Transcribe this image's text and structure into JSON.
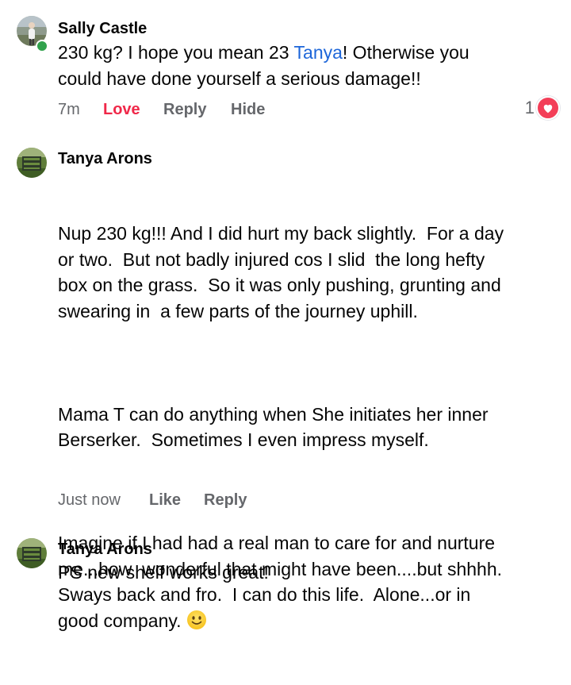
{
  "comments": [
    {
      "author": "Sally Castle",
      "online": true,
      "text_before_mention": "230 kg? I hope you mean 23 ",
      "mention": "Tanya",
      "text_after_mention": "! Otherwise you\ncould have done yourself a serious damage!!",
      "time": "7m",
      "love_label": "Love",
      "reply_label": "Reply",
      "hide_label": "Hide",
      "reaction_count": "1",
      "reaction_icon": "heart-icon"
    },
    {
      "author": "Tanya Arons",
      "paragraph1": "Nup 230 kg!!! And I did hurt my back slightly.  For a day\nor two.  But not badly injured cos I slid  the long hefty\nbox on the grass.  So it was only pushing, grunting and\nswearing in  a few parts of the journey uphill.",
      "paragraph2": "Mama T can do anything when She initiates her inner\nBerserker.  Sometimes I even impress myself.",
      "paragraph3": "Imagine if I had had a real man to care for and nurture\nme...how  wonderful that might have been....but shhhh.\nSways back and fro.  I can do this life.  Alone...or in\ngood company. ",
      "emoji": "slightly-smiling-face-emoji",
      "time": "Just now",
      "like_label": "Like",
      "reply_label": "Reply"
    },
    {
      "author": "Tanya Arons",
      "text": "PS new shelf works great!"
    }
  ],
  "colors": {
    "mention": "#1d66d9",
    "love": "#f02849",
    "meta": "#65676b",
    "online": "#31a24c",
    "heart_badge": "#f33e58"
  }
}
